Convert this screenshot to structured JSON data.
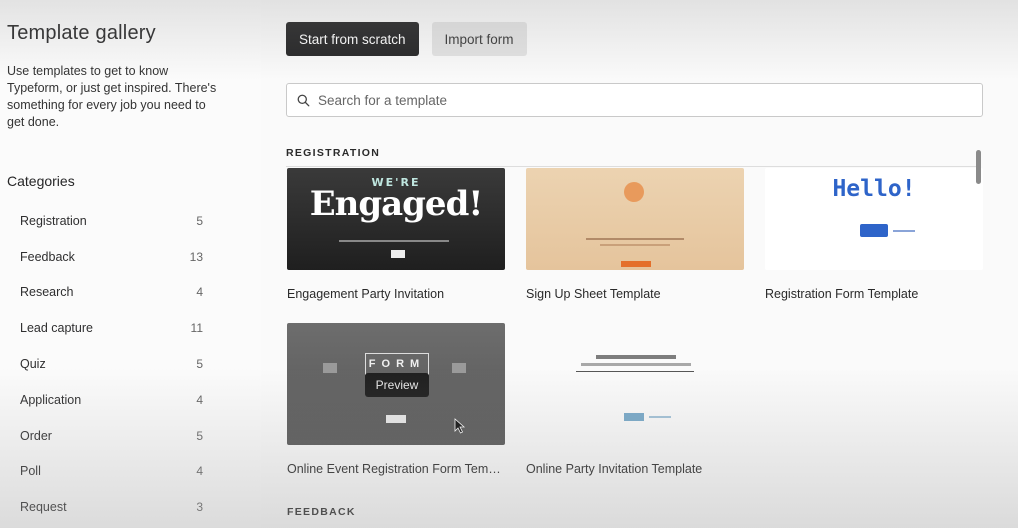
{
  "sidebar": {
    "title": "Template gallery",
    "description": "Use templates to get to know Typeform, or just get inspired. There's something for every job you need to get done.",
    "categories_title": "Categories",
    "categories": [
      {
        "label": "Registration",
        "count": "5"
      },
      {
        "label": "Feedback",
        "count": "13"
      },
      {
        "label": "Research",
        "count": "4"
      },
      {
        "label": "Lead capture",
        "count": "11"
      },
      {
        "label": "Quiz",
        "count": "5"
      },
      {
        "label": "Application",
        "count": "4"
      },
      {
        "label": "Order",
        "count": "5"
      },
      {
        "label": "Poll",
        "count": "4"
      },
      {
        "label": "Request",
        "count": "3"
      }
    ]
  },
  "toolbar": {
    "start_label": "Start from scratch",
    "import_label": "Import form"
  },
  "search": {
    "placeholder": "Search for a template"
  },
  "sections": {
    "registration_label": "REGISTRATION",
    "feedback_label": "FEEDBACK"
  },
  "templates": [
    {
      "title": "Engagement Party Invitation",
      "thumb_text_small": "WE'RE",
      "thumb_text_big": "Engaged!"
    },
    {
      "title": "Sign Up Sheet Template"
    },
    {
      "title": "Registration Form Template",
      "thumb_text_big": "Hello!"
    },
    {
      "title": "Online Event Registration Form Templ...",
      "thumb_text_big": "FORM",
      "overlay_label": "Preview"
    },
    {
      "title": "Online Party Invitation Template"
    }
  ],
  "colors": {
    "dark_button": "#262627",
    "light_button": "#e3e3e3",
    "accent_blue": "#2e64c9"
  }
}
